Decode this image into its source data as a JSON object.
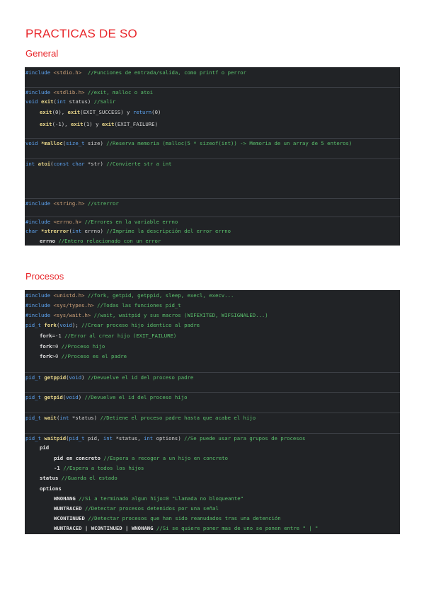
{
  "page": {
    "title": "PRACTICAS DE SO"
  },
  "sections": {
    "general": "General",
    "procesos": "Procesos"
  },
  "general": {
    "l01": {
      "a": "#include ",
      "b": "<stdio.h>",
      "c": "  //Funciones de entrada/salida, como printf o perror"
    },
    "l02": {
      "a": "#include ",
      "b": "<stdlib.h>",
      "c": " //exit, malloc o atoi"
    },
    "l03": {
      "a": "void ",
      "b": "exit",
      "c": "(",
      "d": "int",
      "e": " status) ",
      "f": "//Salir"
    },
    "l04": {
      "a": "exit",
      "b": "(0), ",
      "c": "exit",
      "d": "(EXIT_SUCCESS) y ",
      "e": "return",
      "f": "(0)"
    },
    "l05": {
      "a": "exit",
      "b": "(-1), ",
      "c": "exit",
      "d": "(1) y ",
      "e": "exit",
      "f": "(EXIT_FAILURE)"
    },
    "l06": {
      "a": "void ",
      "b": "*malloc",
      "c": "(",
      "d": "size_t",
      "e": " size) ",
      "f": "//Reserva memoria (malloc(5 * sizeof(int)) -> Memoria de un array de 5 enteros)"
    },
    "l07": {
      "a": "int ",
      "b": "atoi",
      "c": "(",
      "d": "const char",
      "e": " *str) ",
      "f": "//Convierte str a int"
    },
    "l08": {
      "a": "#include ",
      "b": "<string.h>",
      "c": " //strerror"
    },
    "l09": {
      "a": "#include ",
      "b": "<errno.h>",
      "c": " //Errores en la variable errno"
    },
    "l10": {
      "a": "char ",
      "b": "*strerror",
      "c": "(",
      "d": "int",
      "e": " errno) ",
      "f": "//Imprime la descripción del error errno"
    },
    "l11": {
      "a": "errno",
      "b": " //Entero relacionado con un error"
    }
  },
  "procesos": {
    "l01": {
      "a": "#include ",
      "b": "<unistd.h>",
      "c": " //fork, getpid, getppid, sleep, execl, execv..."
    },
    "l02": {
      "a": "#include ",
      "b": "<sys/types.h>",
      "c": " //Todas las funciones pid_t"
    },
    "l03": {
      "a": "#include ",
      "b": "<sys/wait.h>",
      "c": " //wait, waitpid y sus macros (WIFEXITED, WIFSIGNALED...)"
    },
    "l04": {
      "a": "pid_t ",
      "b": "fork",
      "c": "(",
      "d": "void",
      "e": "); ",
      "f": "//Crear proceso hijo identico al padre"
    },
    "l05": {
      "a": "fork",
      "b": "=-1 ",
      "c": "//Error al crear hijo (EXIT_FAILURE)"
    },
    "l06": {
      "a": "fork",
      "b": "=0 ",
      "c": "//Proceso hijo"
    },
    "l07": {
      "a": "fork",
      "b": ">0 ",
      "c": "//Proceso es el padre"
    },
    "l08": {
      "a": "pid_t ",
      "b": "getppid",
      "c": "(",
      "d": "void",
      "e": ") ",
      "f": "//Devuelve el id del proceso padre"
    },
    "l09": {
      "a": "pid_t ",
      "b": "getpid",
      "c": "(",
      "d": "void",
      "e": ") ",
      "f": "//Devuelve el id del proceso hijo"
    },
    "l10": {
      "a": "pid_t ",
      "b": "wait",
      "c": "(",
      "d": "int",
      "e": " *status) ",
      "f": "//Detiene el proceso padre hasta que acabe el hijo"
    },
    "l11": {
      "a": "pid_t ",
      "b": "waitpid",
      "c": "(",
      "d": "pid_t",
      "e": " pid, ",
      "f": "int",
      "g": " *status, ",
      "h": "int",
      "i": " options) ",
      "j": "//Se puede usar para grupos de procesos"
    },
    "l12": {
      "a": "pid"
    },
    "l13": {
      "a": "pid en concreto",
      "b": " //Espera a recoger a un hijo en concreto"
    },
    "l14": {
      "a": "-1",
      "b": " //Espera a todos los hijos"
    },
    "l15": {
      "a": "status",
      "b": " //Guarda el estado"
    },
    "l16": {
      "a": "options"
    },
    "l17": {
      "a": "WNOHANG",
      "b": " //Si a terminado algun hijo=0 \"Llamada no bloqueante\""
    },
    "l18": {
      "a": "WUNTRACED",
      "b": " //Detectar procesos detenidos por una señal"
    },
    "l19": {
      "a": "WCONTINUED",
      "b": " //Detectar procesos que han sido reanudados tras una detención"
    },
    "l20": {
      "a": "WUNTRACED | WCONTINUED | WNOHANG",
      "b": " //Si se quiere poner mas de uno se ponen entre \" | \""
    }
  },
  "colors": {
    "title": "#e8262a",
    "code_bg": "#212326",
    "keyword": "#5da3f0",
    "function": "#e8d68a",
    "string": "#cfa37a",
    "comment": "#5bc16d"
  }
}
